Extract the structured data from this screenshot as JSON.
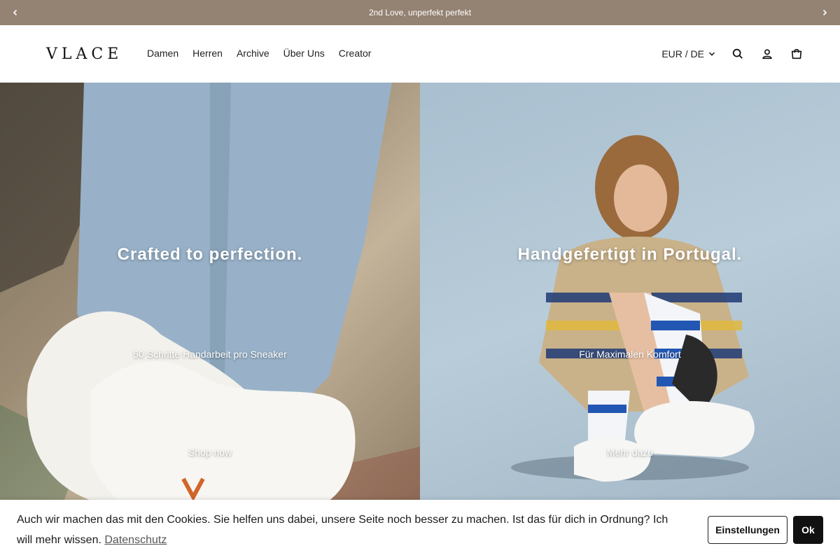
{
  "announcement": {
    "text": "2nd Love, unperfekt perfekt"
  },
  "header": {
    "logo": "VLACE",
    "nav": [
      "Damen",
      "Herren",
      "Archive",
      "Über Uns",
      "Creator"
    ],
    "locale": "EUR / DE"
  },
  "hero": {
    "left": {
      "title": "Crafted to perfection.",
      "subtitle": "50 Schritte Handarbeit pro Sneaker",
      "cta": "Shop now"
    },
    "right": {
      "title": "Handgefertigt in Portugal.",
      "subtitle": "Für Maximalen Komfort",
      "cta": "Mehr dazu"
    }
  },
  "cookie": {
    "message": "Auch wir machen das mit den Cookies. Sie helfen uns dabei, unsere Seite noch besser zu machen. Ist das für dich in Ordnung? Ich will mehr wissen.",
    "privacy_link": "Datenschutz",
    "settings_label": "Einstellungen",
    "ok_label": "Ok"
  },
  "colors": {
    "announcement_bg": "#948272",
    "button_dark": "#111111"
  }
}
